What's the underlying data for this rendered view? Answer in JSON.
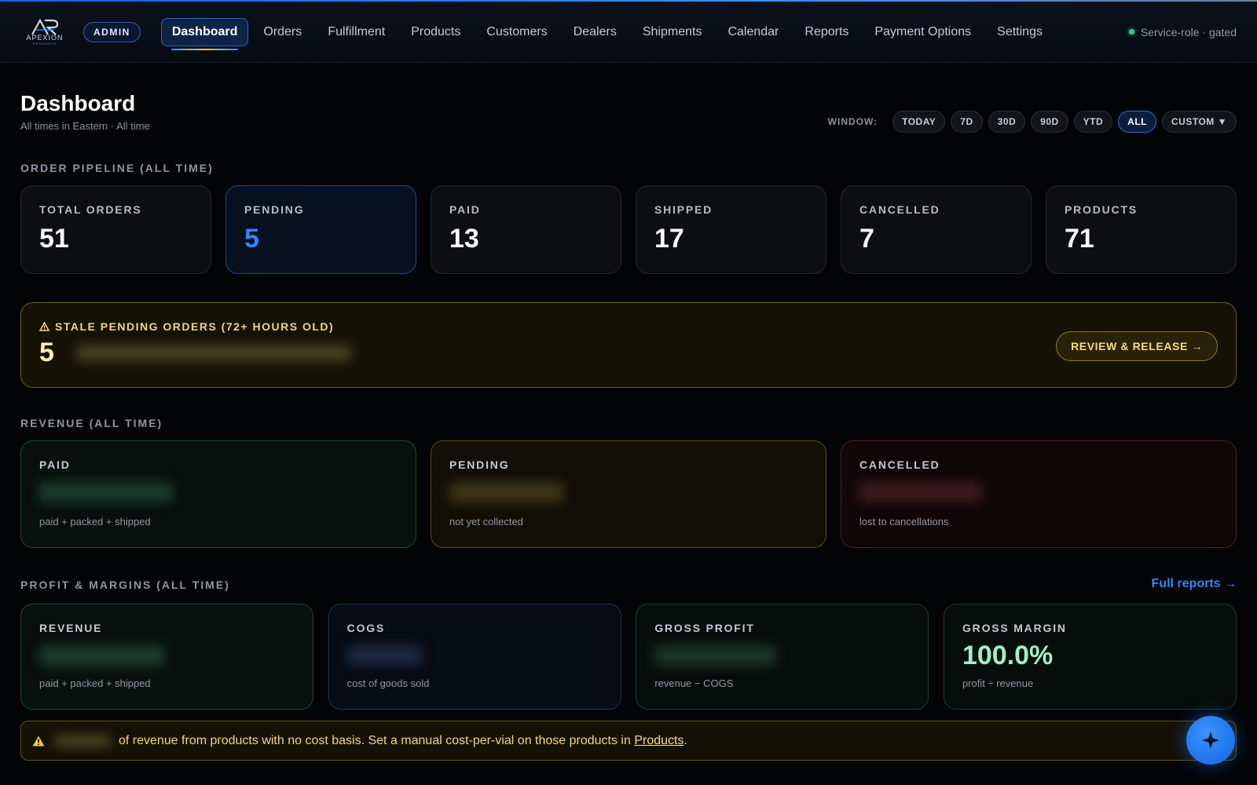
{
  "brand": {
    "logo_text": "APEXION",
    "logo_sub": "RESEARCH"
  },
  "header": {
    "admin_badge": "ADMIN",
    "nav": [
      "Dashboard",
      "Orders",
      "Fulfillment",
      "Products",
      "Customers",
      "Dealers",
      "Shipments",
      "Calendar",
      "Reports",
      "Payment Options",
      "Settings"
    ],
    "active_nav": "Dashboard",
    "service_status": "Service-role · gated"
  },
  "page": {
    "title": "Dashboard",
    "subtitle": "All times in Eastern · All time"
  },
  "window": {
    "label": "WINDOW:",
    "options": [
      "TODAY",
      "7D",
      "30D",
      "90D",
      "YTD",
      "ALL",
      "CUSTOM ▼"
    ],
    "selected": "ALL"
  },
  "pipeline": {
    "section_label": "ORDER PIPELINE (ALL TIME)",
    "cards": [
      {
        "label": "TOTAL ORDERS",
        "value": "51"
      },
      {
        "label": "PENDING",
        "value": "5"
      },
      {
        "label": "PAID",
        "value": "13"
      },
      {
        "label": "SHIPPED",
        "value": "17"
      },
      {
        "label": "CANCELLED",
        "value": "7"
      },
      {
        "label": "PRODUCTS",
        "value": "71"
      }
    ]
  },
  "stale": {
    "title": "STALE PENDING ORDERS (72+ HOURS OLD)",
    "count": "5",
    "button": "REVIEW & RELEASE →"
  },
  "revenue": {
    "section_label": "REVENUE (ALL TIME)",
    "cards": [
      {
        "label": "PAID",
        "note": "paid + packed + shipped"
      },
      {
        "label": "PENDING",
        "note": "not yet collected"
      },
      {
        "label": "CANCELLED",
        "note": "lost to cancellations"
      }
    ]
  },
  "profit": {
    "section_label": "PROFIT & MARGINS (ALL TIME)",
    "full_reports": "Full reports →",
    "cards": [
      {
        "label": "REVENUE",
        "note": "paid + packed + shipped"
      },
      {
        "label": "COGS",
        "note": "cost of goods sold"
      },
      {
        "label": "GROSS PROFIT",
        "note": "revenue − COGS"
      },
      {
        "label": "GROSS MARGIN",
        "value": "100.0%",
        "note": "profit ÷ revenue"
      }
    ]
  },
  "warning": {
    "text": "of revenue from products with no cost basis. Set a manual cost-per-vial on those products in",
    "link": "Products",
    "end": "."
  },
  "colors": {
    "accent": "#2f86ff",
    "success": "#2fd189",
    "warning": "#f3d772",
    "danger": "#4c1f22"
  },
  "icons": {
    "alert": "warning-triangle-icon",
    "fab": "sparkle-icon"
  }
}
